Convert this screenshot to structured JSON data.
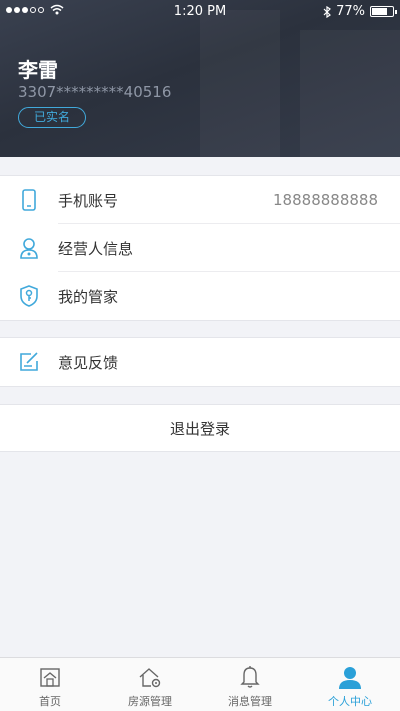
{
  "status_bar": {
    "time": "1:20 PM",
    "battery": "77%",
    "battery_level": 0.77
  },
  "profile": {
    "name": "李雷",
    "id_number": "3307*********40516",
    "verified_badge": "已实名"
  },
  "menu_group_1": [
    {
      "label": "手机账号",
      "value": "18888888888",
      "icon": "phone-icon"
    },
    {
      "label": "经营人信息",
      "icon": "person-icon"
    },
    {
      "label": "我的管家",
      "icon": "shield-key-icon"
    }
  ],
  "menu_group_2": [
    {
      "label": "意见反馈",
      "icon": "feedback-icon"
    }
  ],
  "logout": {
    "label": "退出登录"
  },
  "tabbar": [
    {
      "label": "首页",
      "icon": "home-icon",
      "active": false
    },
    {
      "label": "房源管理",
      "icon": "house-gear-icon",
      "active": false
    },
    {
      "label": "消息管理",
      "icon": "bell-icon",
      "active": false
    },
    {
      "label": "个人中心",
      "icon": "user-icon",
      "active": true
    }
  ],
  "colors": {
    "accent": "#2aa0d8",
    "header_bg": "#2f3541",
    "icon": "#41a9db"
  }
}
